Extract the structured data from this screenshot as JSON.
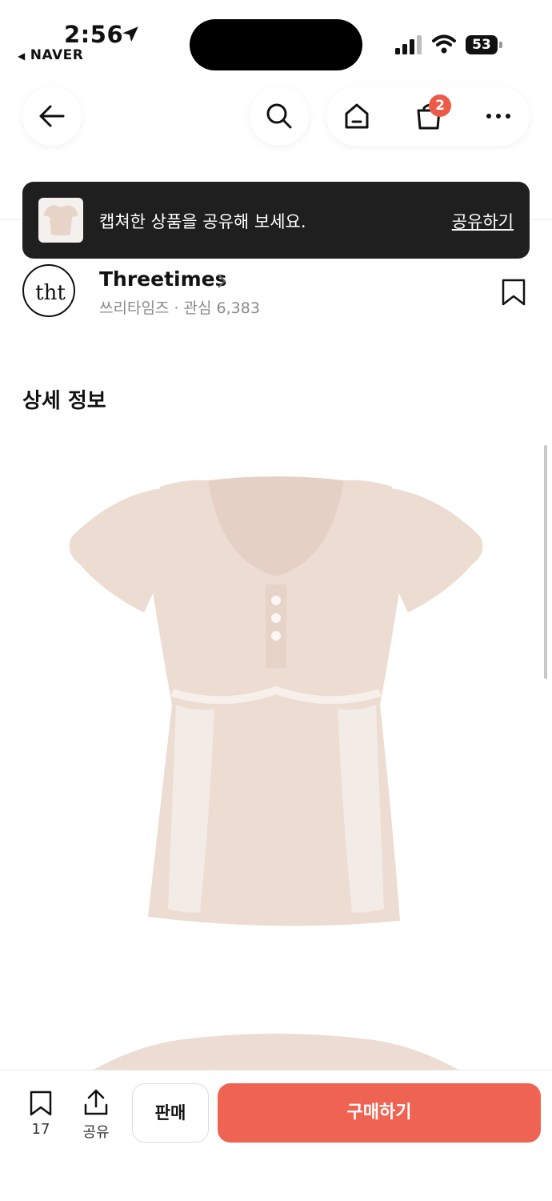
{
  "status_bar": {
    "time": "2:56",
    "back_app": "NAVER",
    "battery": "53"
  },
  "nav": {
    "cart_badge": "2"
  },
  "toast": {
    "message": "캡쳐한 상품을 공유해 보세요.",
    "action": "공유하기"
  },
  "seller": {
    "name": "Threetimes",
    "subtitle": "쓰리타임즈 · 관심 6,383",
    "logo_text": "tht"
  },
  "section": {
    "title": "상세 정보"
  },
  "bottom_bar": {
    "bookmark_count": "17",
    "share_label": "공유",
    "sell_label": "판매",
    "buy_label": "구매하기"
  },
  "colors": {
    "accent": "#ee6352",
    "badge": "#ee5a48",
    "toast_bg": "#1f1f1f",
    "product": "#eddcd2"
  },
  "icons": [
    "location-arrow-icon",
    "signal-icon",
    "wifi-icon",
    "battery-icon",
    "back-arrow-icon",
    "search-icon",
    "home-icon",
    "cart-icon",
    "more-icon",
    "chevron-right-icon",
    "bookmark-icon",
    "share-icon"
  ]
}
